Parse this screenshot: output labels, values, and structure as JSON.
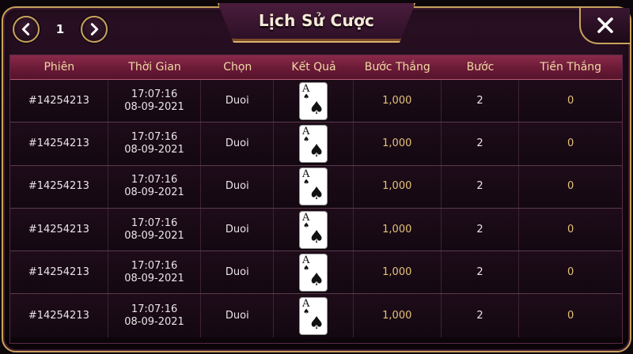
{
  "window": {
    "title": "Lịch Sử Cược",
    "page": "1",
    "close_icon": "close-icon"
  },
  "colors": {
    "frame_gold": "#c9a35c",
    "header_bg": "#6a1a36",
    "header_text": "#f3d9a6",
    "value_gold": "#e6c27a"
  },
  "table": {
    "headers": [
      "Phiên",
      "Thời Gian",
      "Chọn",
      "Kết Quả",
      "Bước Thắng",
      "Bước",
      "Tiền Thắng"
    ],
    "rows": [
      {
        "session": "#14254213",
        "time": "17:07:16",
        "date": "08-09-2021",
        "choice": "Duoi",
        "card_rank": "A",
        "card_suit": "♠",
        "step_win": "1,000",
        "step": "2",
        "money_win": "0"
      },
      {
        "session": "#14254213",
        "time": "17:07:16",
        "date": "08-09-2021",
        "choice": "Duoi",
        "card_rank": "A",
        "card_suit": "♠",
        "step_win": "1,000",
        "step": "2",
        "money_win": "0"
      },
      {
        "session": "#14254213",
        "time": "17:07:16",
        "date": "08-09-2021",
        "choice": "Duoi",
        "card_rank": "A",
        "card_suit": "♠",
        "step_win": "1,000",
        "step": "2",
        "money_win": "0"
      },
      {
        "session": "#14254213",
        "time": "17:07:16",
        "date": "08-09-2021",
        "choice": "Duoi",
        "card_rank": "A",
        "card_suit": "♠",
        "step_win": "1,000",
        "step": "2",
        "money_win": "0"
      },
      {
        "session": "#14254213",
        "time": "17:07:16",
        "date": "08-09-2021",
        "choice": "Duoi",
        "card_rank": "A",
        "card_suit": "♠",
        "step_win": "1,000",
        "step": "2",
        "money_win": "0"
      },
      {
        "session": "#14254213",
        "time": "17:07:16",
        "date": "08-09-2021",
        "choice": "Duoi",
        "card_rank": "A",
        "card_suit": "♠",
        "step_win": "1,000",
        "step": "2",
        "money_win": "0"
      }
    ]
  }
}
